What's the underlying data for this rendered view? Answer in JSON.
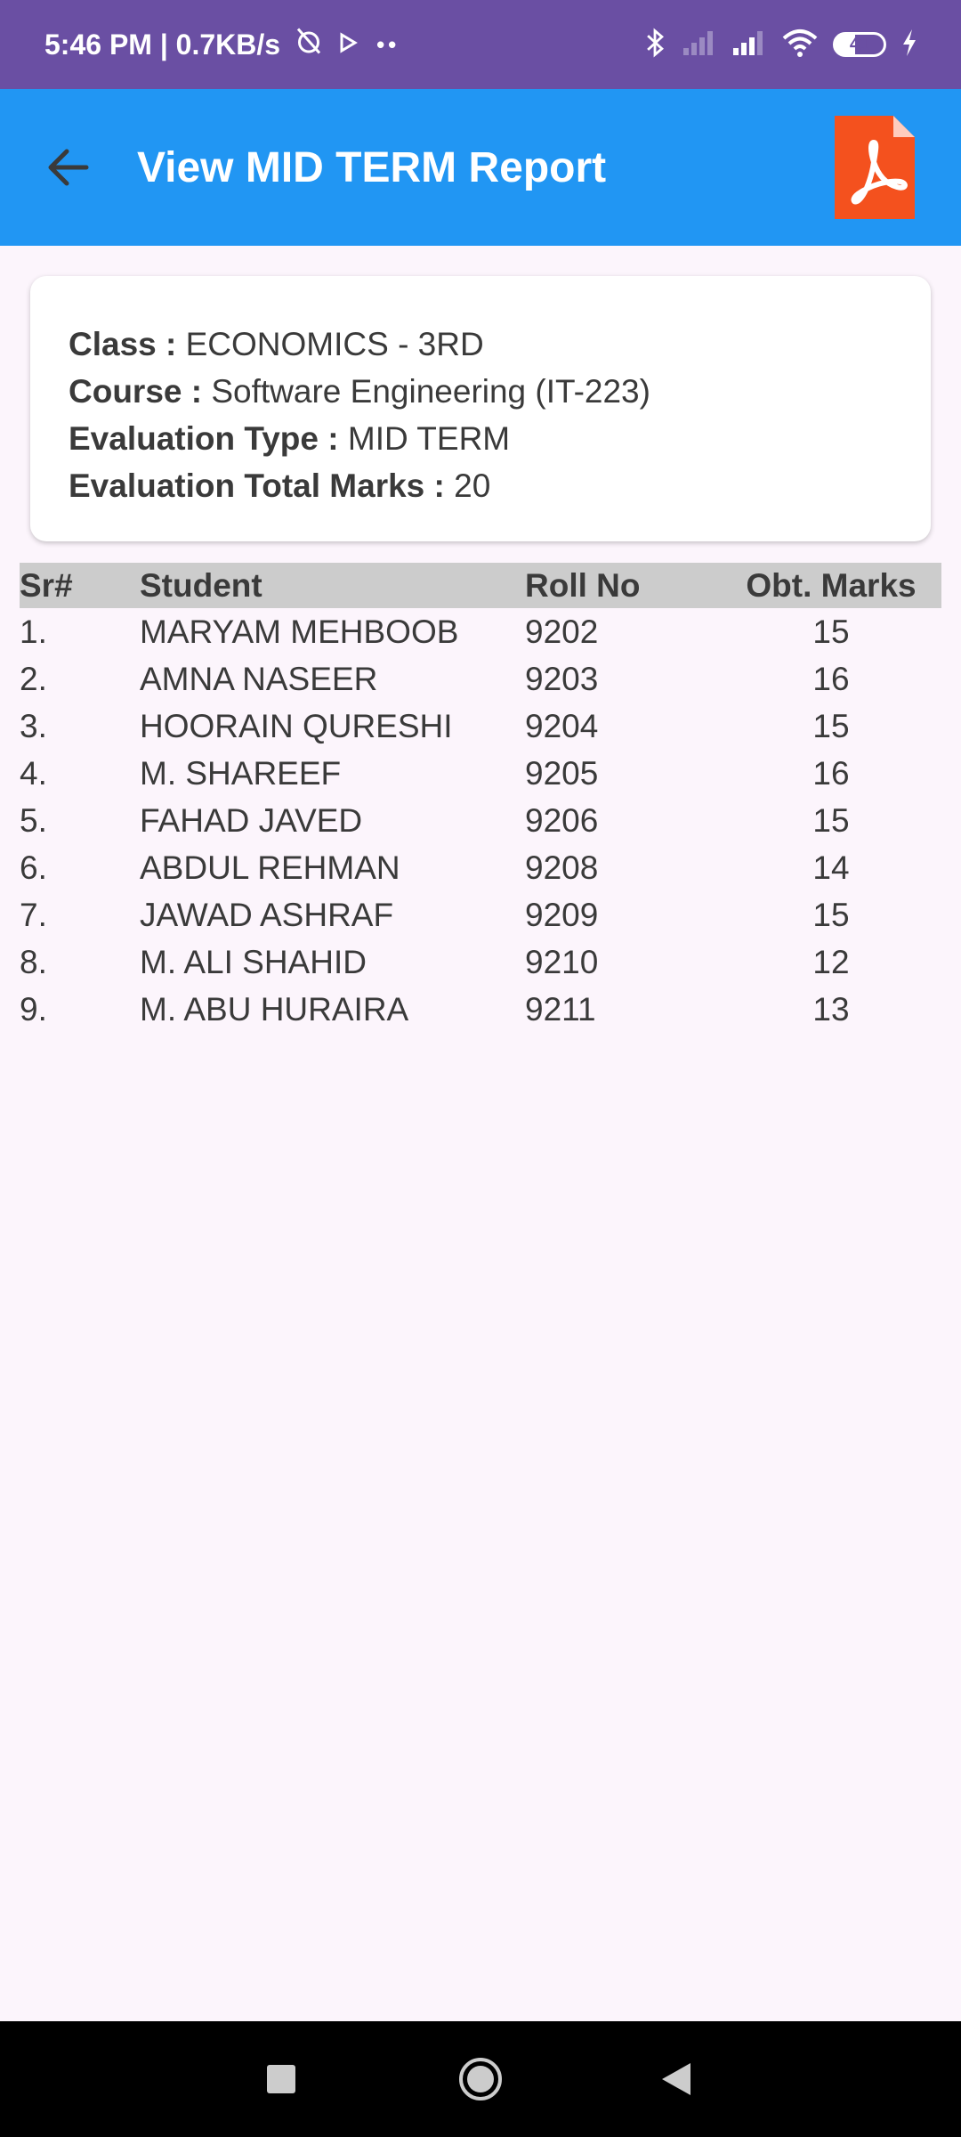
{
  "status_bar": {
    "time_speed": "5:46 PM | 0.7KB/s",
    "more_dots": "••",
    "battery": "41"
  },
  "app_bar": {
    "title": "View MID TERM Report"
  },
  "info": {
    "class_label": "Class :",
    "class_value": "ECONOMICS - 3RD",
    "course_label": "Course :",
    "course_value": "Software Engineering (IT-223)",
    "eval_type_label": "Evaluation Type :",
    "eval_type_value": "MID TERM",
    "total_label": "Evaluation Total Marks :",
    "total_value": "20"
  },
  "table": {
    "headers": [
      "Sr#",
      "Student",
      "Roll No",
      "Obt. Marks"
    ],
    "rows": [
      {
        "sr": "1.",
        "student": "MARYAM MEHBOOB",
        "roll": "9202",
        "marks": "15"
      },
      {
        "sr": "2.",
        "student": "AMNA NASEER",
        "roll": "9203",
        "marks": "16"
      },
      {
        "sr": "3.",
        "student": "HOORAIN QURESHI",
        "roll": "9204",
        "marks": "15"
      },
      {
        "sr": "4.",
        "student": "M. SHAREEF",
        "roll": "9205",
        "marks": "16"
      },
      {
        "sr": "5.",
        "student": "FAHAD JAVED",
        "roll": "9206",
        "marks": "15"
      },
      {
        "sr": "6.",
        "student": "ABDUL REHMAN",
        "roll": "9208",
        "marks": "14"
      },
      {
        "sr": "7.",
        "student": "JAWAD ASHRAF",
        "roll": "9209",
        "marks": "15"
      },
      {
        "sr": "8.",
        "student": "M. ALI SHAHID",
        "roll": "9210",
        "marks": "12"
      },
      {
        "sr": "9.",
        "student": "M. ABU HURAIRA",
        "roll": "9211",
        "marks": "13"
      }
    ]
  },
  "colors": {
    "status_bar": "#6a4fa3",
    "app_bar": "#2196f3",
    "pdf_icon": "#f4511e",
    "background": "#fcf5fc",
    "table_header": "#cccccc"
  },
  "icons": [
    "back-arrow-icon",
    "pdf-icon",
    "alarm-off-icon",
    "play-icon",
    "bluetooth-icon",
    "signal-icon",
    "wifi-icon",
    "battery-icon",
    "charging-icon",
    "nav-recents-icon",
    "nav-home-icon",
    "nav-back-icon"
  ]
}
